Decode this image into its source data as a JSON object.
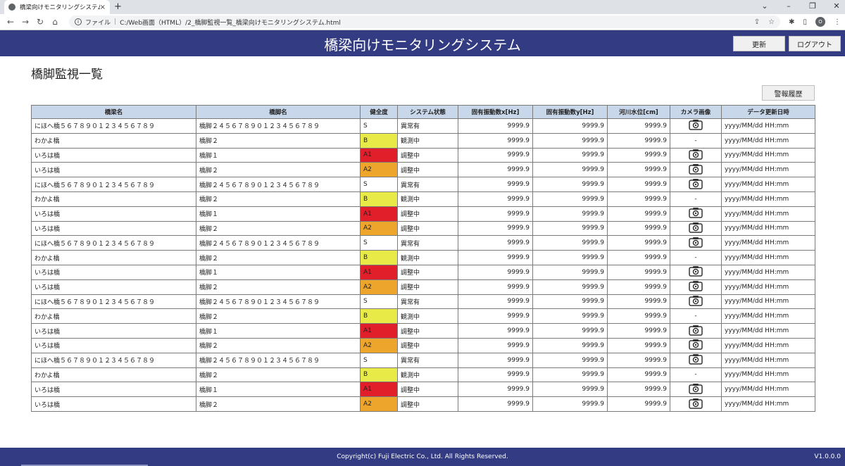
{
  "browser": {
    "tab_title": "橋梁向けモニタリングシステム",
    "tab_close": "×",
    "new_tab": "+",
    "address_prefix": "ファイル",
    "address_sep": "|",
    "address_url": "C:/Web画面（HTML）/2_橋脚監視一覧_橋梁向けモニタリングシステム.html",
    "profile_initial": "O"
  },
  "header": {
    "title": "橋梁向けモニタリングシステム",
    "refresh_label": "更新",
    "logout_label": "ログアウト"
  },
  "page": {
    "title": "橋脚監視一覧",
    "alarm_history_label": "警報履歴"
  },
  "table": {
    "columns": [
      "橋梁名",
      "橋脚名",
      "健全度",
      "システム状態",
      "固有振動数x[Hz]",
      "固有振動数y[Hz]",
      "河川水位[cm]",
      "カメラ画像",
      "データ更新日時"
    ],
    "rows": [
      {
        "bridge": "にほへ橋５６７８９０１２３４５６７８９",
        "pier": "橋脚２４５６７８９０１２３４５６７８９",
        "health": "S",
        "status": "異常有",
        "fx": "9999.9",
        "fy": "9999.9",
        "level": "9999.9",
        "camera": true,
        "updated": "yyyy/MM/dd HH:mm"
      },
      {
        "bridge": "わかよ橋",
        "pier": "橋脚２",
        "health": "B",
        "status": "観測中",
        "fx": "9999.9",
        "fy": "9999.9",
        "level": "9999.9",
        "camera": false,
        "updated": "yyyy/MM/dd HH:mm"
      },
      {
        "bridge": "いろは橋",
        "pier": "橋脚１",
        "health": "A1",
        "status": "調整中",
        "fx": "9999.9",
        "fy": "9999.9",
        "level": "9999.9",
        "camera": true,
        "updated": "yyyy/MM/dd HH:mm"
      },
      {
        "bridge": "いろは橋",
        "pier": "橋脚２",
        "health": "A2",
        "status": "調整中",
        "fx": "9999.9",
        "fy": "9999.9",
        "level": "9999.9",
        "camera": true,
        "updated": "yyyy/MM/dd HH:mm"
      },
      {
        "bridge": "にほへ橋５６７８９０１２３４５６７８９",
        "pier": "橋脚２４５６７８９０１２３４５６７８９",
        "health": "S",
        "status": "異常有",
        "fx": "9999.9",
        "fy": "9999.9",
        "level": "9999.9",
        "camera": true,
        "updated": "yyyy/MM/dd HH:mm"
      },
      {
        "bridge": "わかよ橋",
        "pier": "橋脚２",
        "health": "B",
        "status": "観測中",
        "fx": "9999.9",
        "fy": "9999.9",
        "level": "9999.9",
        "camera": false,
        "updated": "yyyy/MM/dd HH:mm"
      },
      {
        "bridge": "いろは橋",
        "pier": "橋脚１",
        "health": "A1",
        "status": "調整中",
        "fx": "9999.9",
        "fy": "9999.9",
        "level": "9999.9",
        "camera": true,
        "updated": "yyyy/MM/dd HH:mm"
      },
      {
        "bridge": "いろは橋",
        "pier": "橋脚２",
        "health": "A2",
        "status": "調整中",
        "fx": "9999.9",
        "fy": "9999.9",
        "level": "9999.9",
        "camera": true,
        "updated": "yyyy/MM/dd HH:mm"
      },
      {
        "bridge": "にほへ橋５６７８９０１２３４５６７８９",
        "pier": "橋脚２４５６７８９０１２３４５６７８９",
        "health": "S",
        "status": "異常有",
        "fx": "9999.9",
        "fy": "9999.9",
        "level": "9999.9",
        "camera": true,
        "updated": "yyyy/MM/dd HH:mm"
      },
      {
        "bridge": "わかよ橋",
        "pier": "橋脚２",
        "health": "B",
        "status": "観測中",
        "fx": "9999.9",
        "fy": "9999.9",
        "level": "9999.9",
        "camera": false,
        "updated": "yyyy/MM/dd HH:mm"
      },
      {
        "bridge": "いろは橋",
        "pier": "橋脚１",
        "health": "A1",
        "status": "調整中",
        "fx": "9999.9",
        "fy": "9999.9",
        "level": "9999.9",
        "camera": true,
        "updated": "yyyy/MM/dd HH:mm"
      },
      {
        "bridge": "いろは橋",
        "pier": "橋脚２",
        "health": "A2",
        "status": "調整中",
        "fx": "9999.9",
        "fy": "9999.9",
        "level": "9999.9",
        "camera": true,
        "updated": "yyyy/MM/dd HH:mm"
      },
      {
        "bridge": "にほへ橋５６７８９０１２３４５６７８９",
        "pier": "橋脚２４５６７８９０１２３４５６７８９",
        "health": "S",
        "status": "異常有",
        "fx": "9999.9",
        "fy": "9999.9",
        "level": "9999.9",
        "camera": true,
        "updated": "yyyy/MM/dd HH:mm"
      },
      {
        "bridge": "わかよ橋",
        "pier": "橋脚２",
        "health": "B",
        "status": "観測中",
        "fx": "9999.9",
        "fy": "9999.9",
        "level": "9999.9",
        "camera": false,
        "updated": "yyyy/MM/dd HH:mm"
      },
      {
        "bridge": "いろは橋",
        "pier": "橋脚１",
        "health": "A1",
        "status": "調整中",
        "fx": "9999.9",
        "fy": "9999.9",
        "level": "9999.9",
        "camera": true,
        "updated": "yyyy/MM/dd HH:mm"
      },
      {
        "bridge": "いろは橋",
        "pier": "橋脚２",
        "health": "A2",
        "status": "調整中",
        "fx": "9999.9",
        "fy": "9999.9",
        "level": "9999.9",
        "camera": true,
        "updated": "yyyy/MM/dd HH:mm"
      },
      {
        "bridge": "にほへ橋５６７８９０１２３４５６７８９",
        "pier": "橋脚２４５６７８９０１２３４５６７８９",
        "health": "S",
        "status": "異常有",
        "fx": "9999.9",
        "fy": "9999.9",
        "level": "9999.9",
        "camera": true,
        "updated": "yyyy/MM/dd HH:mm"
      },
      {
        "bridge": "わかよ橋",
        "pier": "橋脚２",
        "health": "B",
        "status": "観測中",
        "fx": "9999.9",
        "fy": "9999.9",
        "level": "9999.9",
        "camera": false,
        "updated": "yyyy/MM/dd HH:mm"
      },
      {
        "bridge": "いろは橋",
        "pier": "橋脚１",
        "health": "A1",
        "status": "調整中",
        "fx": "9999.9",
        "fy": "9999.9",
        "level": "9999.9",
        "camera": true,
        "updated": "yyyy/MM/dd HH:mm"
      },
      {
        "bridge": "いろは橋",
        "pier": "橋脚２",
        "health": "A2",
        "status": "調整中",
        "fx": "9999.9",
        "fy": "9999.9",
        "level": "9999.9",
        "camera": true,
        "updated": "yyyy/MM/dd HH:mm"
      }
    ],
    "no_camera_text": "-"
  },
  "colors": {
    "header_bg": "#333c82",
    "table_header_bg": "#c8d7ea",
    "health_B": "#e8ea48",
    "health_A1": "#e01f2a",
    "health_A2": "#eea52c"
  },
  "footer": {
    "copyright": "Copyright(c) Fuji Electric Co., Ltd. All Rights Reserved.",
    "version": "V1.0.0.0"
  }
}
